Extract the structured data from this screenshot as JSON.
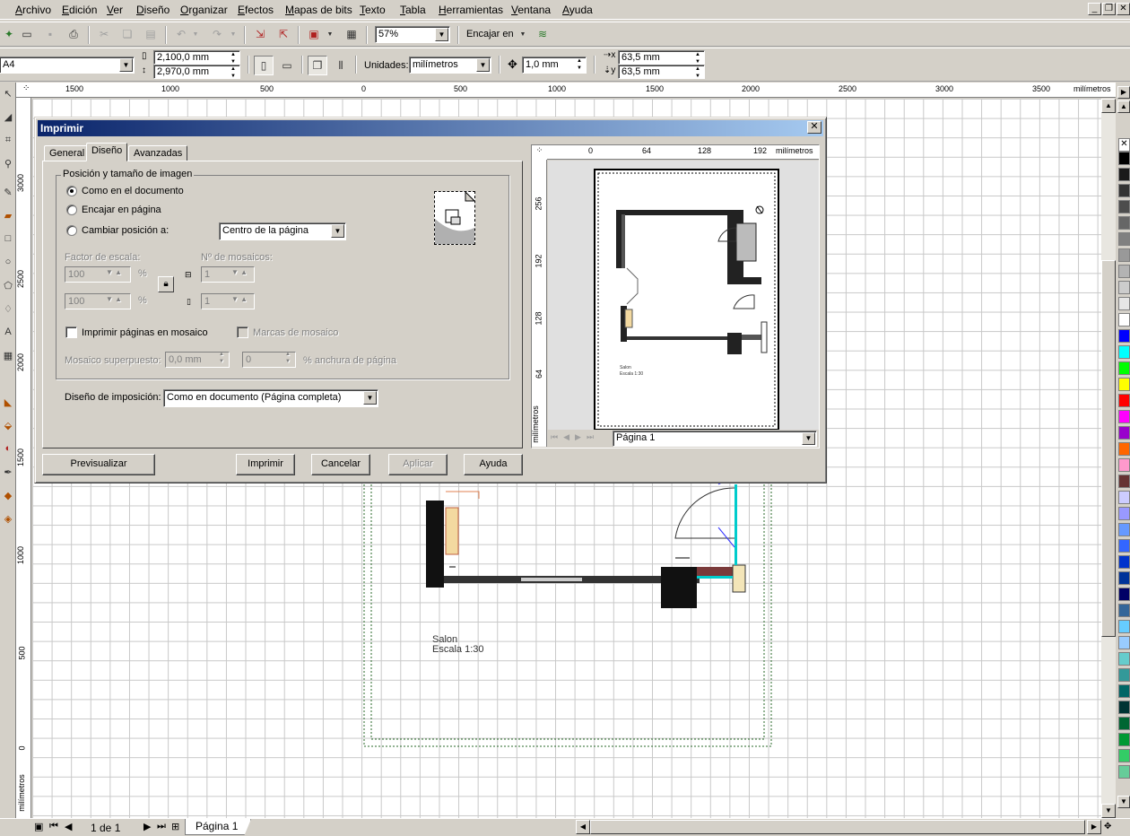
{
  "menu": [
    "Archivo",
    "Edición",
    "Ver",
    "Diseño",
    "Organizar",
    "Efectos",
    "Mapas de bits",
    "Texto",
    "Tabla",
    "Herramientas",
    "Ventana",
    "Ayuda"
  ],
  "toolbar": {
    "zoom": "57%",
    "snap": "Encajar en"
  },
  "propbar": {
    "paper": "A4",
    "width": "2,100,0 mm",
    "height": "2,970,0 mm",
    "units_label": "Unidades:",
    "units": "milímetros",
    "nudge": "1,0 mm",
    "dup_x": "63,5 mm",
    "dup_y": "63,5 mm"
  },
  "ruler": {
    "h_ticks": [
      "1500",
      "1000",
      "500",
      "0",
      "500",
      "1000",
      "1500",
      "2000",
      "2500",
      "3000",
      "3500"
    ],
    "v_ticks": [
      "3000",
      "2500",
      "2000",
      "1500",
      "1000",
      "500",
      "0"
    ],
    "unit": "milímetros"
  },
  "canvas": {
    "label_line1": "Salon",
    "label_line2": "Escala 1:30"
  },
  "statusbar": {
    "page_count": "1 de 1",
    "page_tab": "Página 1"
  },
  "dialog": {
    "title": "Imprimir",
    "tabs": [
      "General",
      "Diseño",
      "Avanzadas"
    ],
    "active_tab": 1,
    "group_title": "Posición y tamaño de imagen",
    "radio_as_document": "Como en el documento",
    "radio_fit_page": "Encajar en página",
    "radio_reposition": "Cambiar posición a:",
    "reposition_value": "Centro de la página",
    "scale_label": "Factor de escala:",
    "scale_x": "100",
    "scale_y": "100",
    "percent": "%",
    "tiles_label": "Nº de mosaicos:",
    "tiles_x": "1",
    "tiles_y": "1",
    "tile_pages": "Imprimir páginas en mosaico",
    "tile_marks": "Marcas de mosaico",
    "overlap_label": "Mosaico superpuesto:",
    "overlap_value": "0,0 mm",
    "overlap_pct": "0",
    "overlap_suffix": "% anchura de página",
    "imposition_label": "Diseño de imposición:",
    "imposition_value": "Como en documento (Página completa)",
    "buttons": {
      "preview": "Previsualizar",
      "print": "Imprimir",
      "cancel": "Cancelar",
      "apply": "Aplicar",
      "help": "Ayuda"
    },
    "preview": {
      "ruler_ticks": [
        "0",
        "64",
        "128",
        "192"
      ],
      "ruler_unit": "milímetros",
      "v_ticks": [
        "256",
        "192",
        "128",
        "64"
      ],
      "page_select": "Página 1",
      "label_line1": "Salon",
      "label_line2": "Escala 1:30"
    }
  },
  "palette_colors": [
    "#000000",
    "#1a1a1a",
    "#333333",
    "#4d4d4d",
    "#666666",
    "#808080",
    "#999999",
    "#b3b3b3",
    "#cccccc",
    "#e6e6e6",
    "#ffffff",
    "#0000ff",
    "#00ffff",
    "#00ff00",
    "#ffff00",
    "#ff0000",
    "#ff00ff",
    "#9900cc",
    "#ff6600",
    "#ff99cc",
    "#663333",
    "#ccccff",
    "#9999ff",
    "#6699ff",
    "#3366ff",
    "#0033cc",
    "#003399",
    "#000066",
    "#336699",
    "#66ccff",
    "#99ccff",
    "#66cccc",
    "#339999",
    "#006666",
    "#003333",
    "#006633",
    "#009933",
    "#33cc66",
    "#66cc99"
  ]
}
